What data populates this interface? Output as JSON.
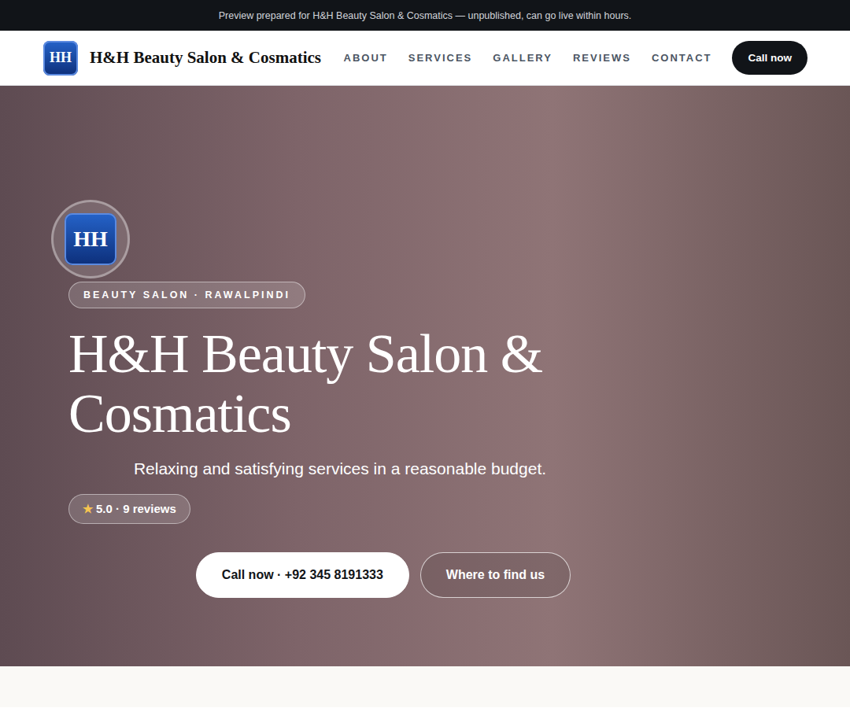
{
  "top_banner": {
    "text": "Preview prepared for H&H Beauty Salon & Cosmatics — unpublished, can go live within hours."
  },
  "nav": {
    "logo": "HH",
    "brand": "H&H Beauty Salon & Cosmatics",
    "links": [
      "ABOUT",
      "SERVICES",
      "GALLERY",
      "REVIEWS",
      "CONTACT"
    ],
    "cta": "Call now"
  },
  "hero": {
    "logo": "HH",
    "eyebrow": "BEAUTY SALON · RAWALPINDI",
    "title": "H&H Beauty Salon & Cosmatics",
    "tagline": "Relaxing and satisfying services in a reasonable budget.",
    "rating": {
      "star": "★",
      "text": "5.0 · 9 reviews"
    },
    "buttons": [
      {
        "label": "Call now · +92 345 8191333",
        "kind": "primary"
      },
      {
        "label": "Where to find us",
        "kind": "outline"
      }
    ]
  }
}
